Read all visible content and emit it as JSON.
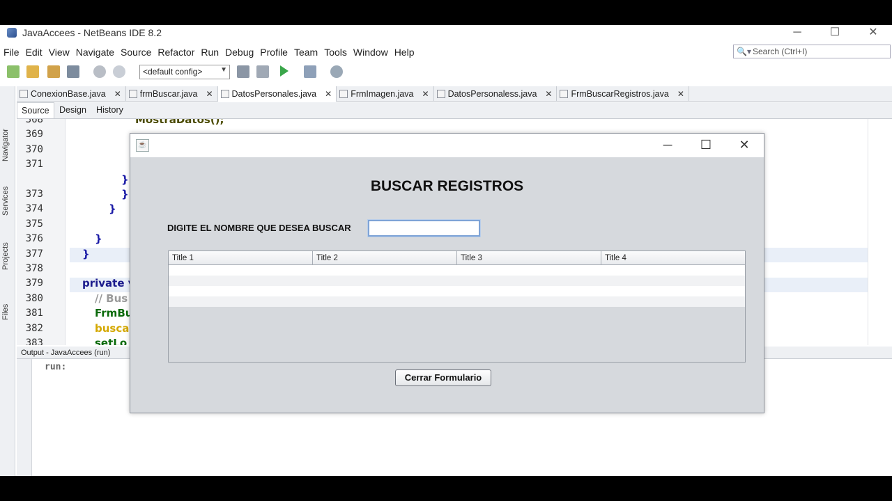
{
  "window": {
    "title": "JavaAccees - NetBeans IDE 8.2",
    "minimize": "─",
    "maximize": "☐",
    "close": "✕"
  },
  "menu": [
    "File",
    "Edit",
    "View",
    "Navigate",
    "Source",
    "Refactor",
    "Run",
    "Debug",
    "Profile",
    "Team",
    "Tools",
    "Window",
    "Help"
  ],
  "search": {
    "placeholder": "Search (Ctrl+I)"
  },
  "toolbar": {
    "config": "<default config>"
  },
  "side_tabs": [
    "Navigator",
    "Services",
    "Projects",
    "Files"
  ],
  "editor_tabs": [
    {
      "label": "ConexionBase.java",
      "active": false
    },
    {
      "label": "frmBuscar.java",
      "active": false
    },
    {
      "label": "DatosPersonales.java",
      "active": true
    },
    {
      "label": "FrmImagen.java",
      "active": false
    },
    {
      "label": "DatosPersonaless.java",
      "active": false
    },
    {
      "label": "FrmBuscarRegistros.java",
      "active": false
    }
  ],
  "sub_tabs": [
    "Source",
    "Design",
    "History"
  ],
  "code_lines": [
    {
      "n": "368",
      "text": "MostraDatos();",
      "color": "#4a4a00",
      "indent": 170
    },
    {
      "n": "369",
      "text": "",
      "color": "#000",
      "indent": 0
    },
    {
      "n": "370",
      "text": "",
      "color": "#000",
      "indent": 0
    },
    {
      "n": "371",
      "text": "",
      "color": "#000",
      "indent": 0
    },
    {
      "n": "",
      "text": "}",
      "color": "#1a1aa6",
      "indent": 150
    },
    {
      "n": "373",
      "text": "}",
      "color": "#1a1aa6",
      "indent": 150
    },
    {
      "n": "374",
      "text": "}",
      "color": "#1a1aa6",
      "indent": 132
    },
    {
      "n": "375",
      "text": "",
      "color": "#000",
      "indent": 0
    },
    {
      "n": "376",
      "text": "}",
      "color": "#1a1aa6",
      "indent": 112
    },
    {
      "n": "377",
      "text": "}",
      "color": "#1a1aa6",
      "indent": 94
    },
    {
      "n": "378",
      "text": "",
      "color": "#000",
      "indent": 0
    },
    {
      "n": "379",
      "text": "private v",
      "color": "#1a1a8c",
      "indent": 94
    },
    {
      "n": "380",
      "text": "// Bus",
      "color": "#9a9a9a",
      "indent": 112
    },
    {
      "n": "381",
      "text": "FrmBu",
      "color": "#0a6a0a",
      "indent": 112
    },
    {
      "n": "382",
      "text": "busca",
      "color": "#d4a800",
      "indent": 112
    },
    {
      "n": "383",
      "text": "setLo",
      "color": "#0a6a0a",
      "indent": 112
    }
  ],
  "output": {
    "title": "Output - JavaAccees (run)",
    "text": "run:"
  },
  "dialog": {
    "heading": "BUSCAR REGISTROS",
    "label": "DIGITE EL NOMBRE QUE DESEA BUSCAR",
    "input_value": "",
    "columns": [
      "Title 1",
      "Title 2",
      "Title 3",
      "Title 4"
    ],
    "button": "Cerrar Formulario"
  }
}
